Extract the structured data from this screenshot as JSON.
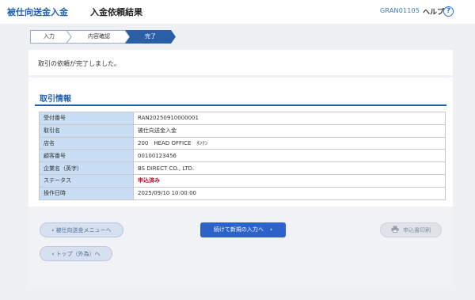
{
  "header": {
    "brand": "被仕向送金入金",
    "title": "入金依頼結果",
    "screen_id": "GRAN01105",
    "help_label": "ヘルプ",
    "help_icon": "?"
  },
  "steps": [
    {
      "label": "入力",
      "state": "done"
    },
    {
      "label": "内容確認",
      "state": "done"
    },
    {
      "label": "完了",
      "state": "current"
    }
  ],
  "message": "取引の依頼が完了しました。",
  "section": {
    "title": "取引情報",
    "rows": [
      {
        "key": "受付番号",
        "value": "RAN20250910000001"
      },
      {
        "key": "取引名",
        "value": "被仕向送金入金"
      },
      {
        "key": "店名",
        "value": "200　HEAD OFFICE　ﾎﾝﾃﾝ"
      },
      {
        "key": "顧客番号",
        "value": "00100123456"
      },
      {
        "key": "企業名（英字）",
        "value": "BS DIRECT CO., LTD."
      },
      {
        "key": "ステータス",
        "value": "申込済み"
      },
      {
        "key": "操作日時",
        "value": "2025/09/10 10:00:00"
      }
    ]
  },
  "buttons": {
    "back_menu": "被仕向送金メニューへ",
    "continue": "続けて新規の入力へ",
    "print": "申込書印刷",
    "back_top": "トップ（外為）へ"
  },
  "colors": {
    "brand": "#1f5fb4",
    "status_red": "#d0021b",
    "primary_button": "#2c62c9",
    "step_active": "#2b5ea8",
    "table_key_bg": "#c9def4"
  },
  "icons": {
    "help": "question-circle-icon",
    "back": "chevron-left-icon",
    "forward": "chevron-right-icon",
    "print": "printer-icon"
  }
}
